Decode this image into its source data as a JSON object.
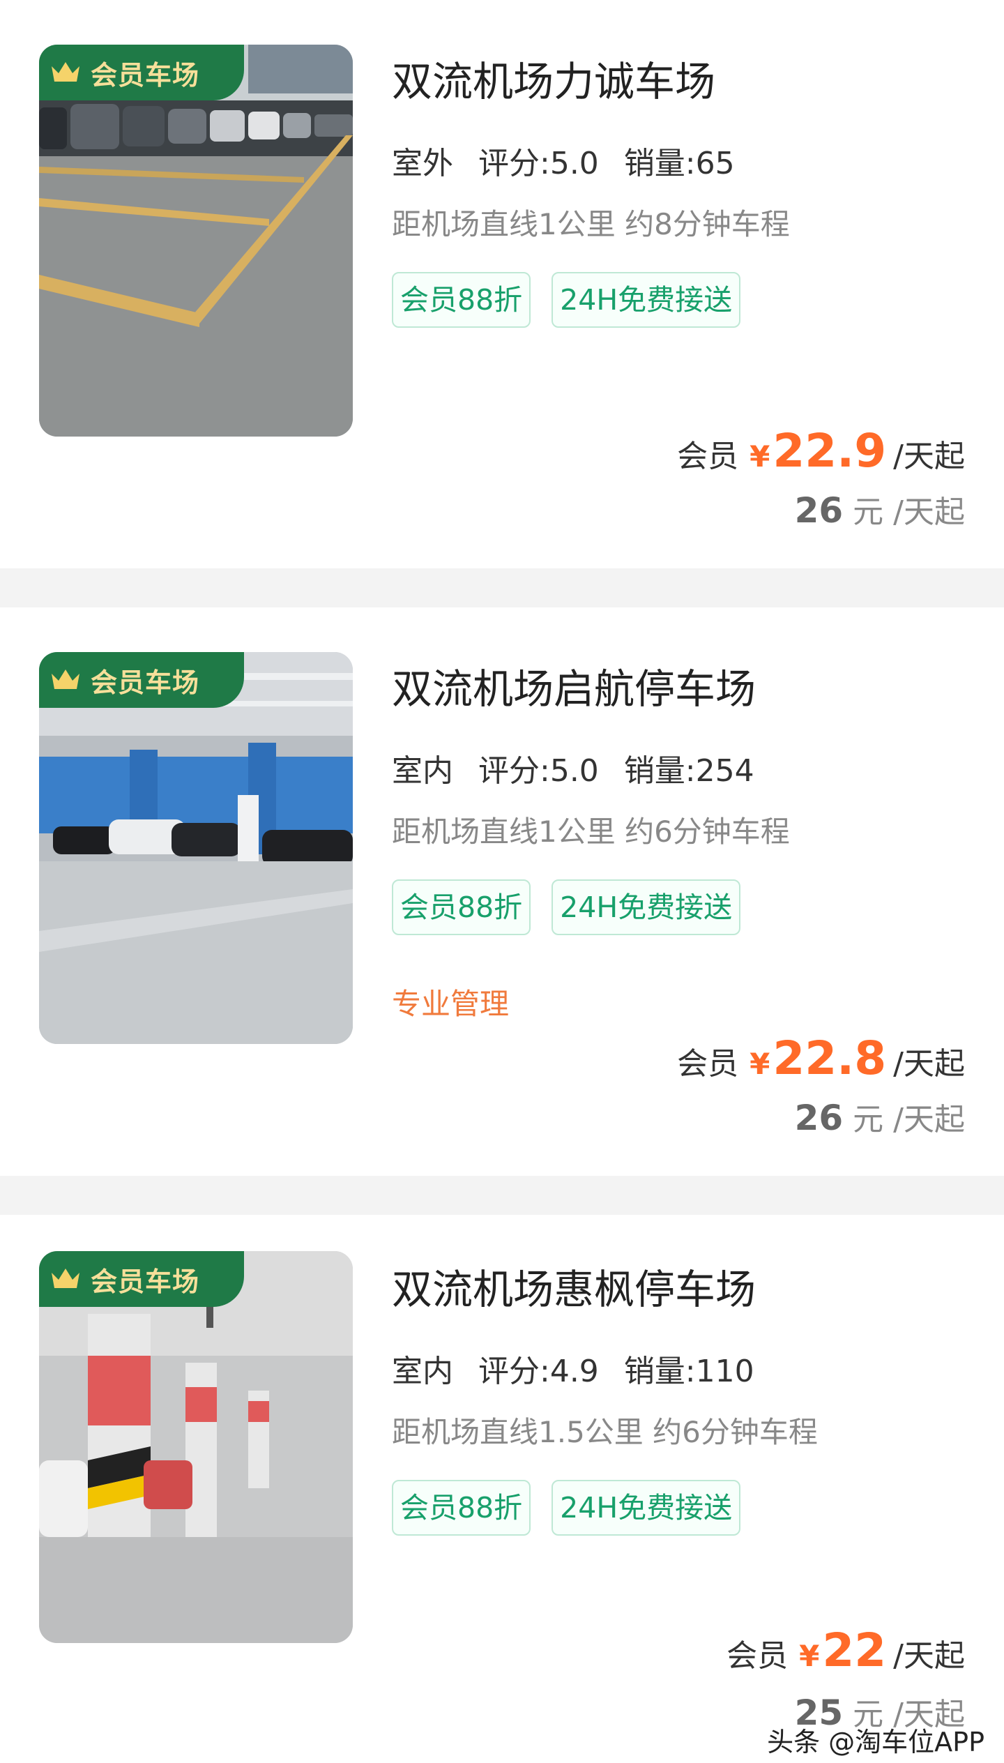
{
  "badge_label": "会员车场",
  "colors": {
    "accent_green": "#1f7a47",
    "tag_green": "#18a06b",
    "price_orange": "#ff6a28"
  },
  "lots": [
    {
      "name": "双流机场力诚车场",
      "environment": "室外",
      "rating_label": "评分:5.0",
      "sales_label": "销量:65",
      "distance": "距机场直线1公里 约8分钟车程",
      "tags": [
        "会员88折",
        "24H免费接送"
      ],
      "feature": "",
      "member_label": "会员",
      "currency": "¥",
      "member_price": "22.9",
      "price_unit": "/天起",
      "original_price": "26",
      "original_unit_yuan": "元",
      "original_unit": "/天起"
    },
    {
      "name": "双流机场启航停车场",
      "environment": "室内",
      "rating_label": "评分:5.0",
      "sales_label": "销量:254",
      "distance": "距机场直线1公里 约6分钟车程",
      "tags": [
        "会员88折",
        "24H免费接送"
      ],
      "feature": "专业管理",
      "member_label": "会员",
      "currency": "¥",
      "member_price": "22.8",
      "price_unit": "/天起",
      "original_price": "26",
      "original_unit_yuan": "元",
      "original_unit": "/天起"
    },
    {
      "name": "双流机场惠枫停车场",
      "environment": "室内",
      "rating_label": "评分:4.9",
      "sales_label": "销量:110",
      "distance": "距机场直线1.5公里 约6分钟车程",
      "tags": [
        "会员88折",
        "24H免费接送"
      ],
      "feature": "",
      "member_label": "会员",
      "currency": "¥",
      "member_price": "22",
      "price_unit": "/天起",
      "original_price": "25",
      "original_unit_yuan": "元",
      "original_unit": "/天起"
    }
  ],
  "watermark": "头条 @淘车位APP"
}
